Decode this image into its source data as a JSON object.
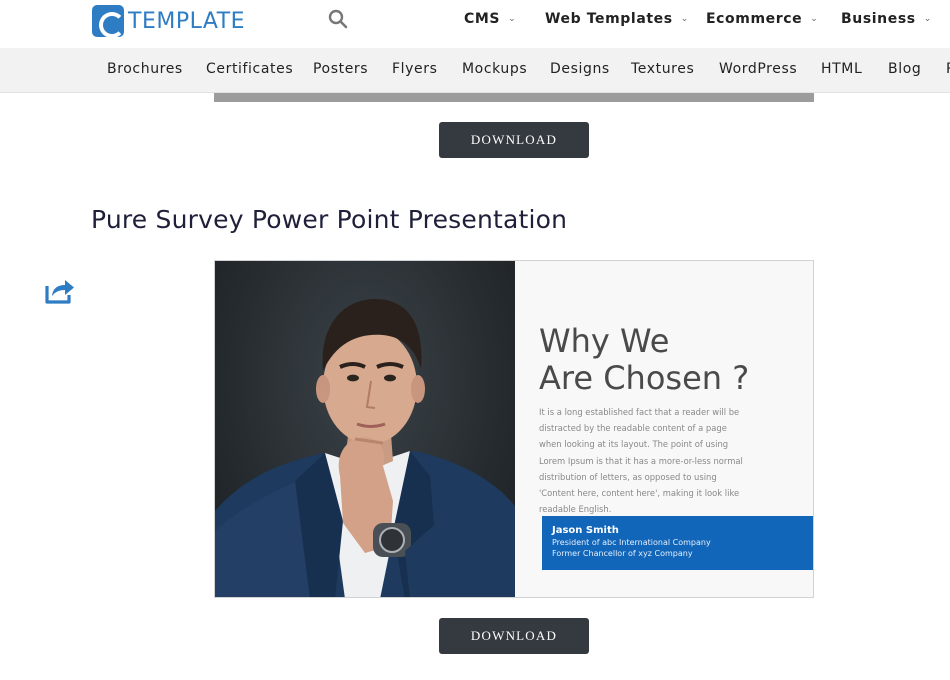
{
  "header": {
    "logo_text": "TEMPLATE",
    "brand_color": "#2e7cc3",
    "nav": [
      {
        "label": "CMS",
        "icon": "chevron-down-icon"
      },
      {
        "label": "Web Templates",
        "icon": "chevron-down-icon"
      },
      {
        "label": "Ecommerce",
        "icon": "chevron-down-icon"
      },
      {
        "label": "Business",
        "icon": "chevron-down-icon"
      }
    ]
  },
  "subnav": {
    "items": [
      "Brochures",
      "Certificates",
      "Posters",
      "Flyers",
      "Mockups",
      "Designs",
      "Textures",
      "WordPress",
      "HTML",
      "Blog",
      "P"
    ]
  },
  "content": {
    "download_label": "DOWNLOAD",
    "section_title": "Pure Survey Power Point Presentation",
    "slide": {
      "heading": "Why We\nAre Chosen ?",
      "body": "It is a long established fact that a reader will be distracted by the readable content of a page when looking at its layout. The point of using Lorem Ipsum is that it has a more-or-less normal distribution of letters, as opposed to using 'Content here, content here', making it look like readable English.",
      "card_name": "Jason Smith",
      "card_line1": "President of abc International Company",
      "card_line2": "Former Chancellor of xyz Company",
      "card_color": "#1166b9"
    }
  }
}
